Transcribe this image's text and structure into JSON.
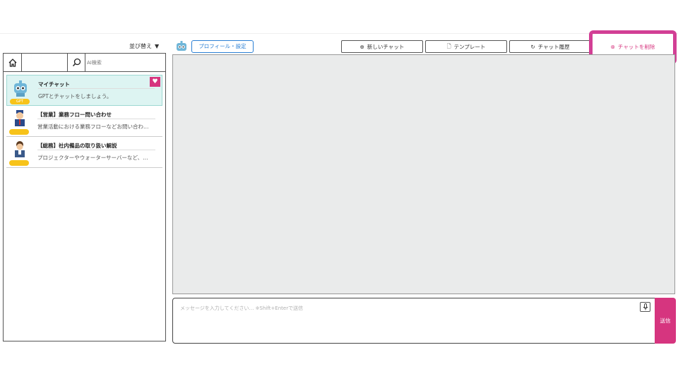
{
  "sidebar": {
    "sort_label": "並び替え",
    "search_placeholder": "AI検索",
    "items": [
      {
        "title": "マイチャット",
        "desc": "GPTとチャットをしましょう。",
        "badge": "GPT"
      },
      {
        "title": "【営業】業務フロー問い合わせ",
        "desc": "営業活動における業務フローなどお問い合わ…",
        "badge": ""
      },
      {
        "title": "【総務】社内備品の取り扱い解説",
        "desc": "プロジェクターやウォーターサーバーなど、…",
        "badge": ""
      }
    ]
  },
  "toolbar": {
    "profile_label": "プロフィール・設定",
    "new_chat_label": "新しいチャット",
    "template_label": "テンプレート",
    "history_label": "チャット履歴",
    "delete_label": "チャットを削除"
  },
  "composer": {
    "placeholder": "メッセージを入力してください… ※Shift+Enterで送信",
    "send_label": "送信"
  },
  "colors": {
    "accent": "#d6357f",
    "highlight": "#d23f95",
    "link": "#2a7fd4"
  }
}
